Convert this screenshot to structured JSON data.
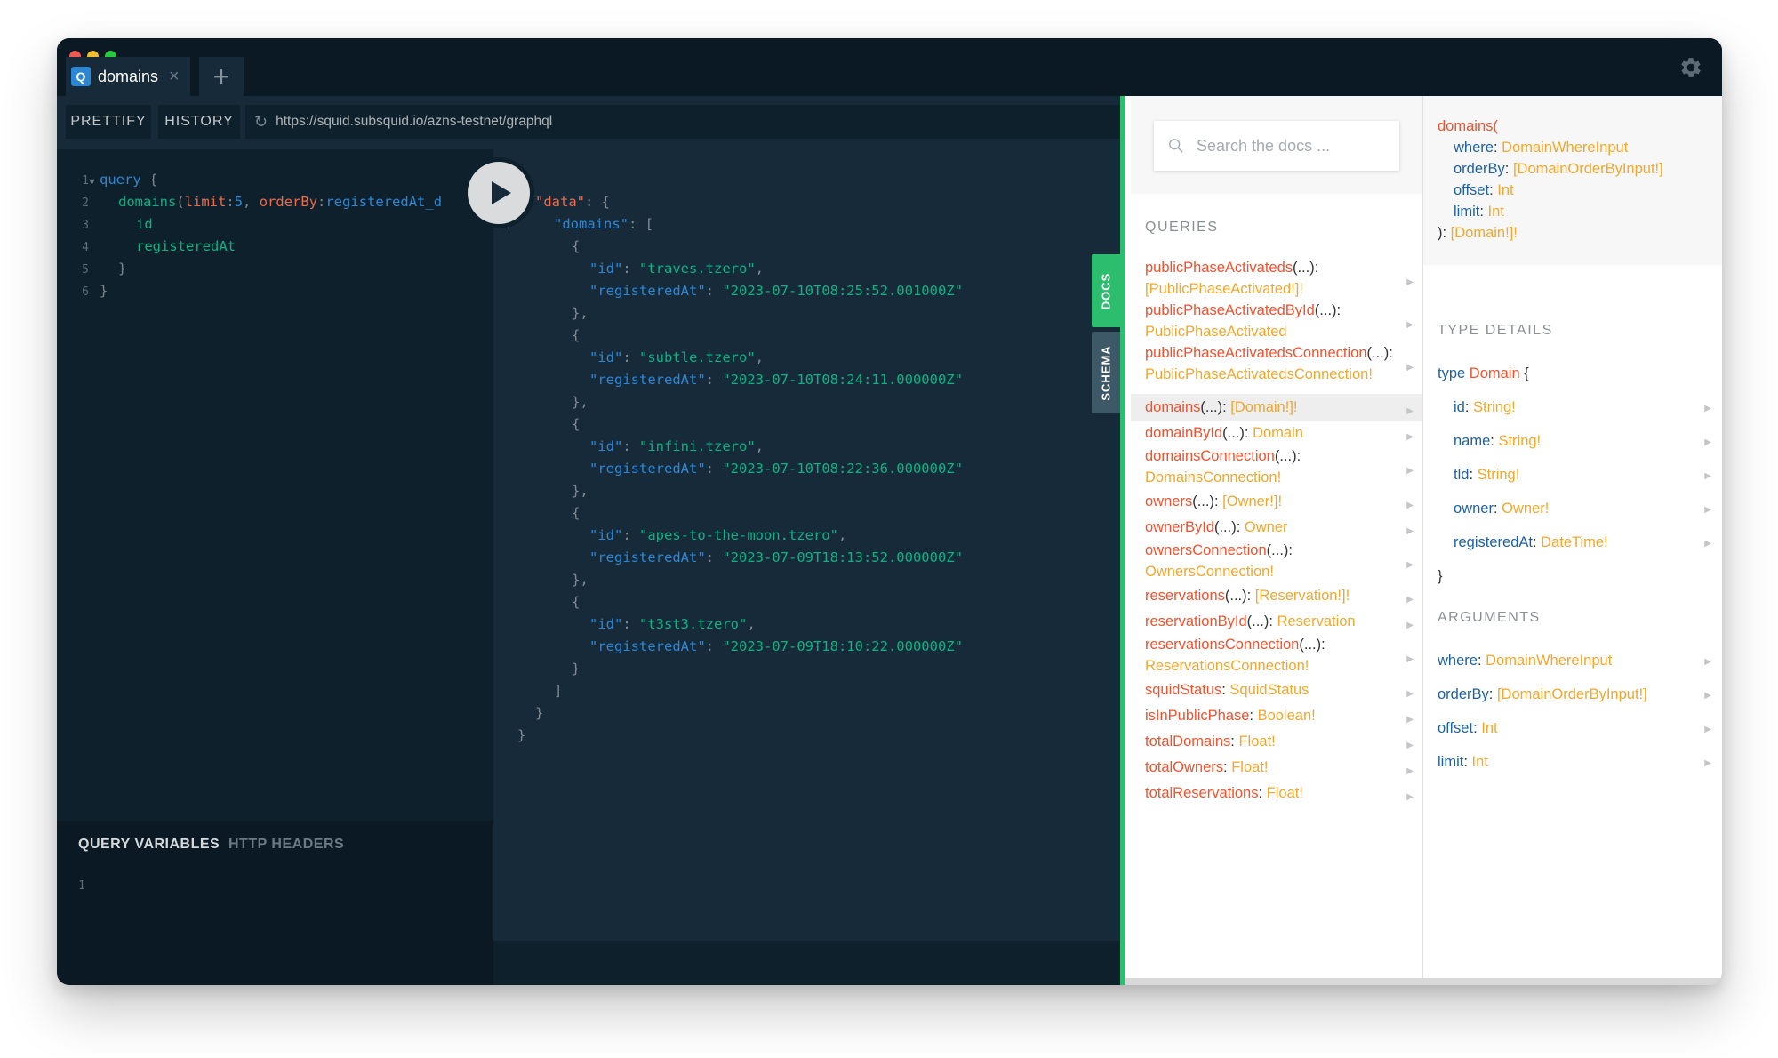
{
  "window": {
    "traffic_lights": [
      {
        "name": "close",
        "color": "#ee5a52"
      },
      {
        "name": "minimize",
        "color": "#f5be2f"
      },
      {
        "name": "zoom",
        "color": "#28c840"
      }
    ]
  },
  "tabs": [
    {
      "icon": "Q",
      "title": "domains",
      "close": "×"
    }
  ],
  "add_tab_label": "+",
  "toolbar": {
    "prettify_label": "PRETTIFY",
    "history_label": "HISTORY",
    "endpoint_url": "https://squid.subsquid.io/azns-testnet/graphql"
  },
  "editor": {
    "line_numbers": [
      "1",
      "2",
      "3",
      "4",
      "5",
      "6"
    ],
    "line1": {
      "kw": "query",
      "brace": "{"
    },
    "line2": {
      "field": "domains",
      "open": "(",
      "arg1": "limit",
      "colon1": ":",
      "val1": "5",
      "comma": ", ",
      "arg2": "orderBy",
      "colon2": ":",
      "val2": "registeredAt_d"
    },
    "line3": {
      "field": "id"
    },
    "line4": {
      "field": "registeredAt"
    },
    "line5": {
      "brace": "}"
    },
    "line6": {
      "brace": "}"
    }
  },
  "variables": {
    "tab_query_variables": "QUERY VARIABLES",
    "tab_http_headers": "HTTP HEADERS",
    "line_number": "1"
  },
  "result": {
    "open": "{",
    "data_key": "\"data\"",
    "domains_key": "\"domains\"",
    "id_key": "\"id\"",
    "registered_key": "\"registeredAt\"",
    "rows": [
      {
        "id": "\"traves.tzero\"",
        "registeredAt": "\"2023-07-10T08:25:52.001000Z\""
      },
      {
        "id": "\"subtle.tzero\"",
        "registeredAt": "\"2023-07-10T08:24:11.000000Z\""
      },
      {
        "id": "\"infini.tzero\"",
        "registeredAt": "\"2023-07-10T08:22:36.000000Z\""
      },
      {
        "id": "\"apes-to-the-moon.tzero\"",
        "registeredAt": "\"2023-07-09T18:13:52.000000Z\""
      },
      {
        "id": "\"t3st3.tzero\"",
        "registeredAt": "\"2023-07-09T18:10:22.000000Z\""
      }
    ]
  },
  "side_tabs": {
    "docs": "DOCS",
    "schema": "SCHEMA"
  },
  "docs": {
    "search_placeholder": "Search the docs ...",
    "queries_heading": "QUERIES",
    "queries": [
      {
        "name": "publicPhaseActivateds",
        "args": "(...)",
        "sep": ":",
        "type": "[PublicPhaseActivated!]!"
      },
      {
        "name": "publicPhaseActivatedById",
        "args": "(...)",
        "sep": ":",
        "type": "PublicPhaseActivated"
      },
      {
        "name": "publicPhaseActivatedsConnection",
        "args": "(...)",
        "sep": ":",
        "type": "PublicPhaseActivatedsConnection!"
      },
      {
        "name": "domains",
        "args": "(...)",
        "sep": ": ",
        "type": "[Domain!]!"
      },
      {
        "name": "domainById",
        "args": "(...)",
        "sep": ": ",
        "type": "Domain"
      },
      {
        "name": "domainsConnection",
        "args": "(...)",
        "sep": ":",
        "type": "DomainsConnection!"
      },
      {
        "name": "owners",
        "args": "(...)",
        "sep": ": ",
        "type": "[Owner!]!"
      },
      {
        "name": "ownerById",
        "args": "(...)",
        "sep": ": ",
        "type": "Owner"
      },
      {
        "name": "ownersConnection",
        "args": "(...)",
        "sep": ":",
        "type": "OwnersConnection!"
      },
      {
        "name": "reservations",
        "args": "(...)",
        "sep": ": ",
        "type": "[Reservation!]!"
      },
      {
        "name": "reservationById",
        "args": "(...)",
        "sep": ": ",
        "type": "Reservation"
      },
      {
        "name": "reservationsConnection",
        "args": "(...)",
        "sep": ":",
        "type": "ReservationsConnection!"
      },
      {
        "name": "squidStatus",
        "args": "",
        "sep": ": ",
        "type": "SquidStatus"
      },
      {
        "name": "isInPublicPhase",
        "args": "",
        "sep": ": ",
        "type": "Boolean!"
      },
      {
        "name": "totalDomains",
        "args": "",
        "sep": ": ",
        "type": "Float!"
      },
      {
        "name": "totalOwners",
        "args": "",
        "sep": ": ",
        "type": "Float!"
      },
      {
        "name": "totalReservations",
        "args": "",
        "sep": ": ",
        "type": "Float!"
      }
    ],
    "signature": {
      "field": "domains(",
      "args": [
        {
          "name": "where",
          "type": "DomainWhereInput"
        },
        {
          "name": "orderBy",
          "type": "[DomainOrderByInput!]"
        },
        {
          "name": "offset",
          "type": "Int"
        },
        {
          "name": "limit",
          "type": "Int"
        }
      ],
      "close": "): ",
      "return_type": "[Domain!]!"
    },
    "type_details_heading": "TYPE DETAILS",
    "type_keyword": "type",
    "type_name": "Domain",
    "type_open": "{",
    "type_close": "}",
    "type_fields": [
      {
        "name": "id",
        "type": "String!"
      },
      {
        "name": "name",
        "type": "String!"
      },
      {
        "name": "tld",
        "type": "String!"
      },
      {
        "name": "owner",
        "type": "Owner!"
      },
      {
        "name": "registeredAt",
        "type": "DateTime!"
      }
    ],
    "arguments_heading": "ARGUMENTS",
    "arguments": [
      {
        "name": "where",
        "type": "DomainWhereInput"
      },
      {
        "name": "orderBy",
        "type": "[DomainOrderByInput!]"
      },
      {
        "name": "offset",
        "type": "Int"
      },
      {
        "name": "limit",
        "type": "Int"
      }
    ]
  }
}
